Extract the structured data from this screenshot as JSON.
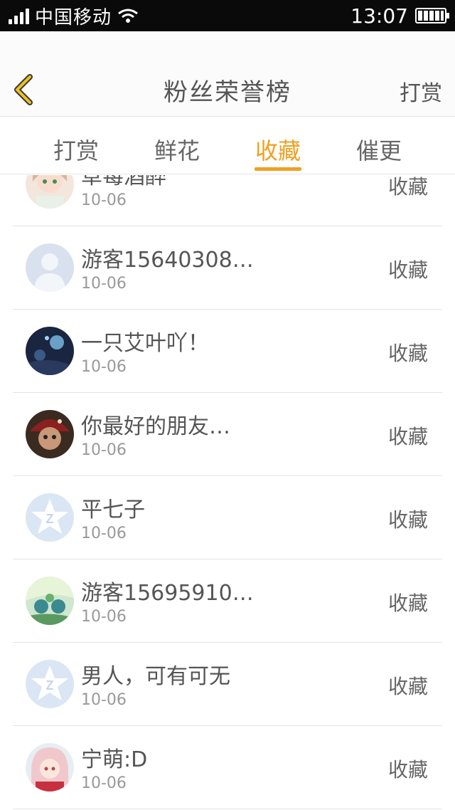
{
  "status_bar": {
    "carrier": "中国移动",
    "time": "13:07"
  },
  "nav": {
    "title": "粉丝荣誉榜",
    "action": "打赏",
    "back_icon": "chevron-left-icon",
    "back_color": "#f0c020"
  },
  "tabs": [
    {
      "label": "打赏",
      "active": false
    },
    {
      "label": "鲜花",
      "active": false
    },
    {
      "label": "收藏",
      "active": true
    },
    {
      "label": "催更",
      "active": false
    }
  ],
  "accent_color": "#f0a020",
  "list": [
    {
      "name": "草莓酒醉",
      "date": "10-06",
      "action": "收藏",
      "avatar": "anime-girl-avatar"
    },
    {
      "name": "游客15640308…",
      "date": "10-06",
      "action": "收藏",
      "avatar": "default-user-avatar"
    },
    {
      "name": "一只艾叶吖！",
      "date": "10-06",
      "action": "收藏",
      "avatar": "dark-blue-art-avatar"
    },
    {
      "name": "你最好的朋友…",
      "date": "10-06",
      "action": "收藏",
      "avatar": "red-hat-character-avatar"
    },
    {
      "name": "平七子",
      "date": "10-06",
      "action": "收藏",
      "avatar": "qq-default-avatar"
    },
    {
      "name": "游客15695910…",
      "date": "10-06",
      "action": "收藏",
      "avatar": "green-art-avatar"
    },
    {
      "name": "男人，可有可无",
      "date": "10-06",
      "action": "收藏",
      "avatar": "qq-default-avatar"
    },
    {
      "name": "宁萌:D",
      "date": "10-06",
      "action": "收藏",
      "avatar": "pink-hair-avatar"
    }
  ]
}
